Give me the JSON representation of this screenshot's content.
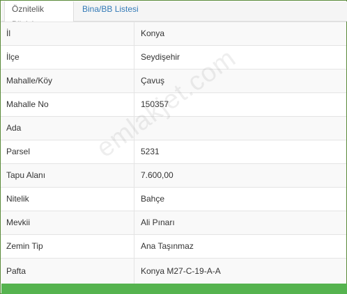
{
  "tabs": [
    {
      "label": "Öznitelik Bilgisi",
      "active": true
    },
    {
      "label": "Bina/BB Listesi",
      "active": false
    }
  ],
  "rows": [
    {
      "label": "İl",
      "value": "Konya"
    },
    {
      "label": "İlçe",
      "value": "Seydişehir"
    },
    {
      "label": "Mahalle/Köy",
      "value": "Çavuş"
    },
    {
      "label": "Mahalle No",
      "value": "150357"
    },
    {
      "label": "Ada",
      "value": ""
    },
    {
      "label": "Parsel",
      "value": "5231"
    },
    {
      "label": "Tapu Alanı",
      "value": "7.600,00"
    },
    {
      "label": "Nitelik",
      "value": "Bahçe"
    },
    {
      "label": "Mevkii",
      "value": "Ali Pınarı"
    },
    {
      "label": "Zemin Tip",
      "value": "Ana Taşınmaz"
    },
    {
      "label": "Pafta",
      "value": "Konya M27-C-19-A-A"
    }
  ],
  "watermark": "emlakjet.com",
  "colors": {
    "tab_link": "#337ab7",
    "bottom_bar": "#55b34f",
    "row_alt": "#f9f9f9"
  }
}
